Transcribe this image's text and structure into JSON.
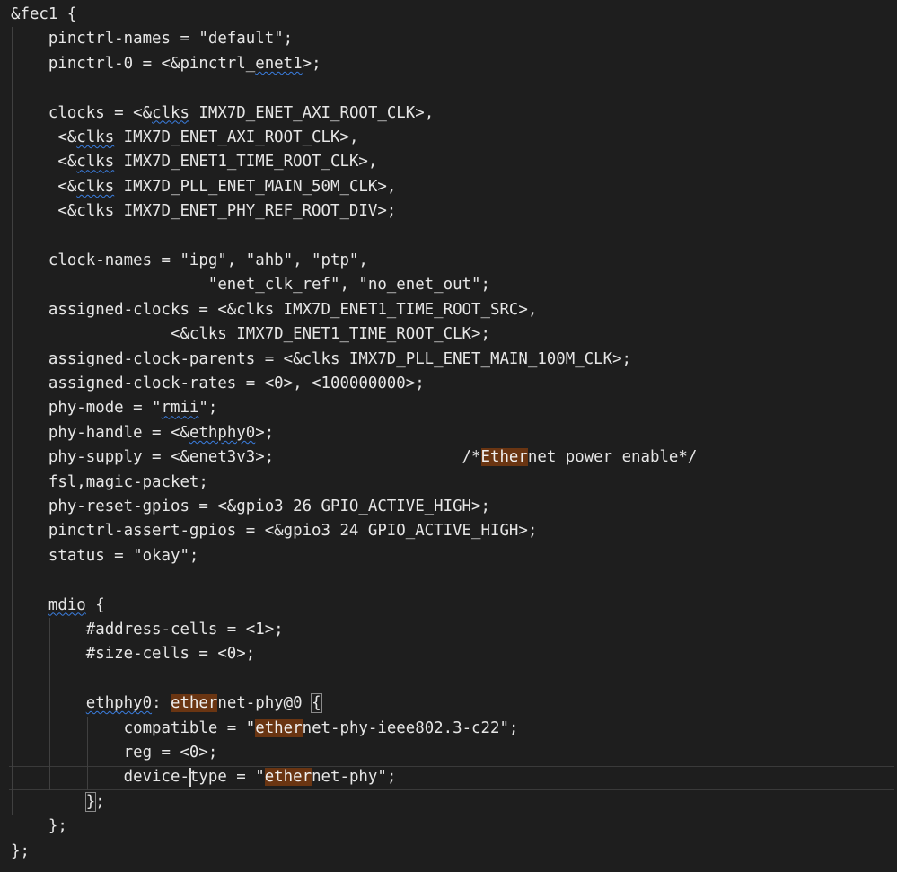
{
  "editor": {
    "colors": {
      "background": "#1e1e1e",
      "text": "#e6e6e6",
      "find_highlight": "#6a3512",
      "squiggle": "#3a7ee0",
      "indent_guide": "#404040"
    },
    "current_line": 31,
    "caret": {
      "line": 31,
      "column": 19
    },
    "lines": [
      [
        {
          "t": "&fec1 {"
        }
      ],
      [
        {
          "t": "    pinctrl-names = \"default\";"
        }
      ],
      [
        {
          "t": "    pinctrl-0 = <&pinctrl_"
        },
        {
          "t": "enet1",
          "sq": true
        },
        {
          "t": ">;"
        }
      ],
      [
        {
          "t": ""
        }
      ],
      [
        {
          "t": "    clocks = <&"
        },
        {
          "t": "clks",
          "sq": true
        },
        {
          "t": " IMX7D_ENET_AXI_ROOT_CLK>,"
        }
      ],
      [
        {
          "t": "     <&"
        },
        {
          "t": "clks",
          "sq": true
        },
        {
          "t": " IMX7D_ENET_AXI_ROOT_CLK>,"
        }
      ],
      [
        {
          "t": "     <&"
        },
        {
          "t": "clks",
          "sq": true
        },
        {
          "t": " IMX7D_ENET1_TIME_ROOT_CLK>,"
        }
      ],
      [
        {
          "t": "     <&"
        },
        {
          "t": "clks",
          "sq": true
        },
        {
          "t": " IMX7D_PLL_ENET_MAIN_50M_CLK>,"
        }
      ],
      [
        {
          "t": "     <&clks IMX7D_ENET_PHY_REF_ROOT_DIV>;"
        }
      ],
      [
        {
          "t": ""
        }
      ],
      [
        {
          "t": "    clock-names = \"ipg\", \"ahb\", \"ptp\","
        }
      ],
      [
        {
          "t": "                     \"enet_clk_ref\", \"no_enet_out\";"
        }
      ],
      [
        {
          "t": "    assigned-clocks = <&clks IMX7D_ENET1_TIME_ROOT_SRC>,"
        }
      ],
      [
        {
          "t": "                 <&clks IMX7D_ENET1_TIME_ROOT_CLK>;"
        }
      ],
      [
        {
          "t": "    assigned-clock-parents = <&clks IMX7D_PLL_ENET_MAIN_100M_CLK>;"
        }
      ],
      [
        {
          "t": "    assigned-clock-rates = <0>, <100000000>;"
        }
      ],
      [
        {
          "t": "    phy-mode = \""
        },
        {
          "t": "rmii",
          "sq": true
        },
        {
          "t": "\";"
        }
      ],
      [
        {
          "t": "    phy-handle = <&"
        },
        {
          "t": "ethphy0",
          "sq": true
        },
        {
          "t": ">;"
        }
      ],
      [
        {
          "t": "    phy-supply = <&enet3v3>;                    /*"
        },
        {
          "t": "Ether",
          "hl": true
        },
        {
          "t": "net power enable*/"
        }
      ],
      [
        {
          "t": "    fsl,magic-packet;"
        }
      ],
      [
        {
          "t": "    phy-reset-gpios = <&gpio3 26 GPIO_ACTIVE_HIGH>;"
        }
      ],
      [
        {
          "t": "    pinctrl-assert-gpios = <&gpio3 24 GPIO_ACTIVE_HIGH>;"
        }
      ],
      [
        {
          "t": "    status = \"okay\";"
        }
      ],
      [
        {
          "t": ""
        }
      ],
      [
        {
          "t": "    "
        },
        {
          "t": "mdio",
          "sq": true
        },
        {
          "t": " {"
        }
      ],
      [
        {
          "t": "        #address-cells = <1>;"
        }
      ],
      [
        {
          "t": "        #size-cells = <0>;"
        }
      ],
      [
        {
          "t": ""
        }
      ],
      [
        {
          "t": "        "
        },
        {
          "t": "ethphy0",
          "sq": true
        },
        {
          "t": ": "
        },
        {
          "t": "ether",
          "hl": true
        },
        {
          "t": "net-phy@0 "
        },
        {
          "t": "{",
          "brk": true
        }
      ],
      [
        {
          "t": "            compatible = \""
        },
        {
          "t": "ether",
          "hl": true
        },
        {
          "t": "net-phy-ieee802.3-c22\";"
        }
      ],
      [
        {
          "t": "            reg = <0>;"
        }
      ],
      [
        {
          "t": "            device-type = \""
        },
        {
          "t": "ether",
          "hl": true
        },
        {
          "t": "net-phy\";"
        }
      ],
      [
        {
          "t": "        "
        },
        {
          "t": "}",
          "brk": true
        },
        {
          "t": ";"
        }
      ],
      [
        {
          "t": "    };"
        }
      ],
      [
        {
          "t": "};"
        }
      ]
    ]
  }
}
